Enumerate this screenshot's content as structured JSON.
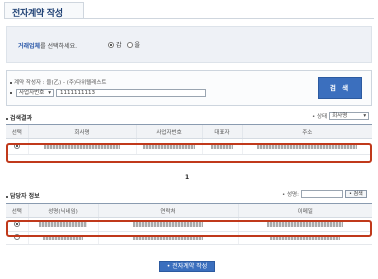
{
  "page_title": "전자계약 작성",
  "selector": {
    "label_bold": "거래업체",
    "label_rest": "를 선택하세요.",
    "options": [
      {
        "label": "갑",
        "checked": true
      },
      {
        "label": "을",
        "checked": false
      }
    ]
  },
  "search_form": {
    "row1": "계약 작성자 : 을(乙) - (주)다위텔레스트",
    "field_select": "사업자번호",
    "field_value": "1111111113",
    "button": "검 색"
  },
  "results": {
    "title": "검색결과",
    "filter_label": "상태",
    "filter_value": "회사명",
    "columns": [
      "선택",
      "회사명",
      "사업자번호",
      "대표자",
      "주소"
    ],
    "rows": [
      {
        "selected": true
      }
    ],
    "page": "1"
  },
  "manager": {
    "title": "담당자 정보",
    "search_label": "성명:",
    "search_value": "",
    "search_button": "검색",
    "columns": [
      "선택",
      "성명(닉네임)",
      "연락처",
      "이메일"
    ],
    "rows": [
      {
        "selected": true
      },
      {
        "selected": false
      }
    ]
  },
  "submit_button": "전자계약 작성"
}
